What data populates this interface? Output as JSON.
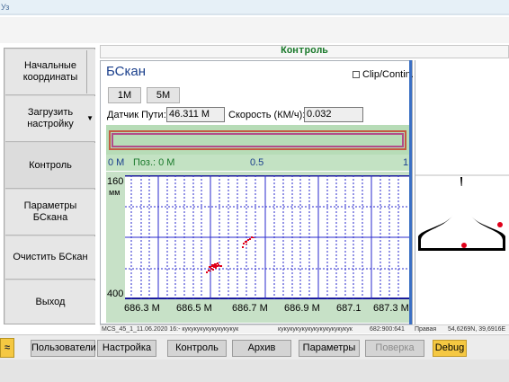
{
  "window": {
    "tab_title": "Уз"
  },
  "sidebar": {
    "items": [
      {
        "label": "Начальные координаты"
      },
      {
        "label": "Загрузить настройку"
      },
      {
        "label": "Контроль"
      },
      {
        "label": "Параметры БСкана"
      },
      {
        "label": "Очистить БСкан"
      },
      {
        "label": "Выход"
      }
    ],
    "dropdown_icon": "triangle-down"
  },
  "header": {
    "title": "Контроль"
  },
  "bscan": {
    "title": "БСкан",
    "clip_label": "Clip/Contin.",
    "clip_checked": false,
    "tabs": [
      "1M",
      "5M"
    ],
    "sensor_label": "Датчик Пути:",
    "sensor_value": "46.311 M",
    "speed_label": "Скорость (КМ/ч):",
    "speed_value": "0.032",
    "scale_start": "0 M",
    "scale_pos": "Поз.: 0 M",
    "scale_mid": "0.5",
    "scale_end": "1",
    "y_top": "160",
    "y_unit": "мм",
    "y_bottom": "400",
    "x_ticks": [
      "686.3 M",
      "686.5 M",
      "686.7 M",
      "686.9 M",
      "687.1",
      "687.3 M"
    ]
  },
  "status": {
    "file": "MCS_45_1_11.06.2020 16:- кукукукукукукукукук",
    "text2": "кукукукукукукукукукукукук",
    "coords": "682:900:641",
    "side": "Правая",
    "gps": "54,6269N, 39,6916E"
  },
  "bottom": {
    "buttons": [
      {
        "label": "Пользователи",
        "disabled": false
      },
      {
        "label": "Настройка",
        "disabled": false
      },
      {
        "label": "Контроль",
        "disabled": false
      },
      {
        "label": "Архив",
        "disabled": false
      },
      {
        "label": "Параметры",
        "disabled": false
      },
      {
        "label": "Поверка",
        "disabled": true
      },
      {
        "label": "Debug",
        "disabled": false
      }
    ],
    "chevron_icon": "double-chevron-up"
  },
  "colors": {
    "accent_green": "#1b7a2c",
    "title_blue": "#1a3f8c",
    "debug_yellow": "#f5c842",
    "marker_red": "#e0001a"
  }
}
